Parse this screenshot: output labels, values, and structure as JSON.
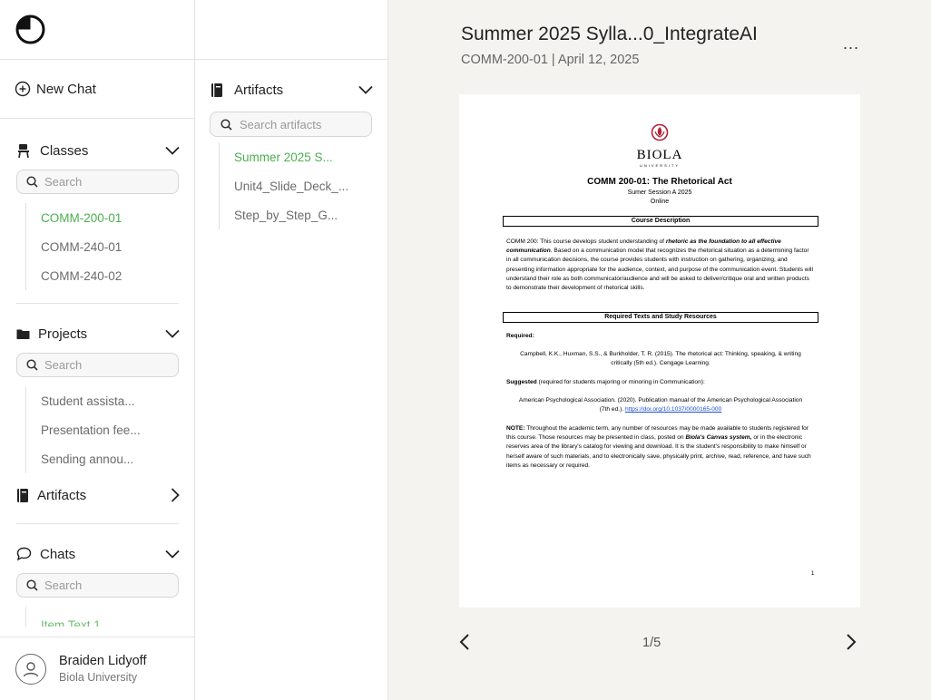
{
  "sidebar": {
    "new_chat_label": "New Chat",
    "classes": {
      "label": "Classes",
      "search_placeholder": "Search",
      "items": [
        "COMM-200-01",
        "COMM-240-01",
        "COMM-240-02"
      ]
    },
    "projects": {
      "label": "Projects",
      "search_placeholder": "Search",
      "items": [
        "Student assista...",
        "Presentation fee...",
        "Sending annou..."
      ]
    },
    "artifacts_label": "Artifacts",
    "chats": {
      "label": "Chats",
      "search_placeholder": "Search",
      "items": [
        "Item Text 1"
      ]
    },
    "user": {
      "name": "Braiden Lidyoff",
      "org": "Biola University"
    }
  },
  "artifact_panel": {
    "label": "Artifacts",
    "search_placeholder": "Search artifacts",
    "items": [
      "Summer 2025 S...",
      "Unit4_Slide_Deck_...",
      "Step_by_Step_G..."
    ]
  },
  "viewer": {
    "title": "Summer 2025 Sylla...0_IntegrateAI",
    "subtitle": "COMM-200-01 | April 12, 2025",
    "more_label": "...",
    "page_count": "1/5",
    "document": {
      "logo_name": "BIOLA",
      "logo_sub": "UNIVERSITY",
      "course_title": "COMM 200-01: The Rhetorical Act",
      "session": "Sumer Session A 2025",
      "mode": "Online",
      "desc_head": "Course Description",
      "desc_p1": "COMM 200: This course develops student understanding of ",
      "desc_p1_em": "rhetoric as the foundation to all effective communication",
      "desc_p1_rest": ". Based on a communication model that recognizes the rhetorical situation as a determining factor in all communication decisions, the course provides students with instruction on gathering, organizing, and presenting information appropriate for the audience, context, and purpose of the communication event. Students will understand their role as both communicator/audience and will be asked to deliver/critique oral and written products to demonstrate their development of rhetorical skills.",
      "texts_head": "Required Texts and Study Resources",
      "required_label": "Required:",
      "required_ref": "Campbell, K.K., Huxman, S.S., & Burkholder, T. R. (2015). The rhetorical act: Thinking, speaking, & writing critically (5th ed.). Cengage Learning.",
      "suggested_label": "Suggested",
      "suggested_rest": " (required for students majoring or minoring in Communication):",
      "suggested_ref": "American Psychological Association. (2020). Publication manual of the American Psychological Association (7th ed.). ",
      "suggested_link": "https://doi.org/10.1037/0000165-000",
      "note_label": "NOTE:",
      "note_p1": " Throughout the academic term, any number of resources may be made available to students registered for this course. Those resources may be presented in class, posted on ",
      "note_em": "Biola's Canvas system,",
      "note_p2": " or in the electronic reserves area of the library's catalog for viewing and download. It is the student's responsibility to make himself or herself aware of such materials, and to electronically save, physically print, archive, read, reference, and have such items as necessary or required.",
      "page_number": "1"
    }
  },
  "colors": {
    "accent_green": "#4caf50",
    "viewer_bg": "#f5f3ef",
    "link_blue": "#1a4fd1"
  },
  "icons": {
    "logo": "app-logo-icon",
    "new_chat": "plus-circle-icon",
    "classes": "desk-chair-icon",
    "projects": "folder-icon",
    "artifacts": "notebook-icon",
    "chats": "chat-bubble-icon",
    "search": "search-icon",
    "expand": "chevron-down-icon",
    "collapse": "chevron-right-icon",
    "user": "user-avatar-icon",
    "prev": "chevron-left-icon",
    "next": "chevron-right-icon"
  }
}
